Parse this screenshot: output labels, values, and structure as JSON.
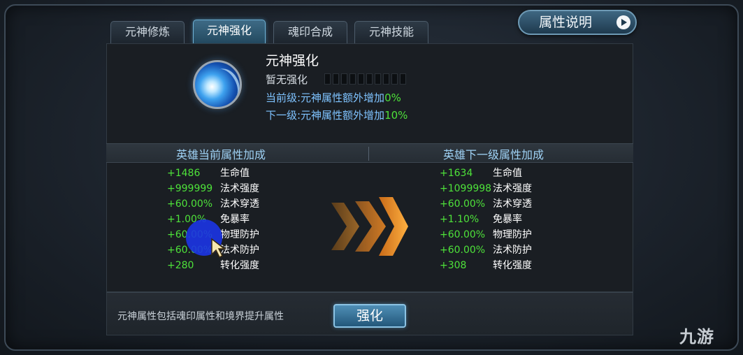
{
  "tabs": [
    {
      "label": "元神修炼",
      "active": false
    },
    {
      "label": "元神强化",
      "active": true
    },
    {
      "label": "魂印合成",
      "active": false
    },
    {
      "label": "元神技能",
      "active": false
    }
  ],
  "top_right_button": {
    "label": "属性说明",
    "icon": "play-icon"
  },
  "skill": {
    "icon": "blue-comet-icon",
    "title": "元神强化",
    "status_label": "暂无强化",
    "progress_segments_filled": 0,
    "progress_segments_total": 10,
    "current_level": {
      "label": "当前级:元神属性额外增加",
      "value": "0%"
    },
    "next_level": {
      "label": "下一级:元神属性额外增加",
      "value": "10%"
    }
  },
  "current_stats": {
    "header": "英雄当前属性加成",
    "rows": [
      {
        "value": "+1486",
        "name": "生命值"
      },
      {
        "value": "+999999",
        "name": "法术强度"
      },
      {
        "value": "+60.00%",
        "name": "法术穿透"
      },
      {
        "value": "+1.00%",
        "name": "免暴率"
      },
      {
        "value": "+60.00%",
        "name": "物理防护"
      },
      {
        "value": "+60.00%",
        "name": "法术防护"
      },
      {
        "value": "+280",
        "name": "转化强度"
      }
    ]
  },
  "next_stats": {
    "header": "英雄下一级属性加成",
    "rows": [
      {
        "value": "+1634",
        "name": "生命值"
      },
      {
        "value": "+1099998",
        "name": "法术强度"
      },
      {
        "value": "+60.00%",
        "name": "法术穿透"
      },
      {
        "value": "+1.10%",
        "name": "免暴率"
      },
      {
        "value": "+60.00%",
        "name": "物理防护"
      },
      {
        "value": "+60.00%",
        "name": "法术防护"
      },
      {
        "value": "+308",
        "name": "转化强度"
      }
    ]
  },
  "bottom": {
    "note": "元神属性包括魂印属性和境界提升属性",
    "button_label": "强化"
  },
  "watermark": "九游",
  "colors": {
    "positive_value": "#4ee23a",
    "info_text": "#7fc3ff",
    "header_text": "#9fd2f5",
    "arrow_orange": "#f08a1c",
    "cursor_blue": "#1c34e6"
  }
}
